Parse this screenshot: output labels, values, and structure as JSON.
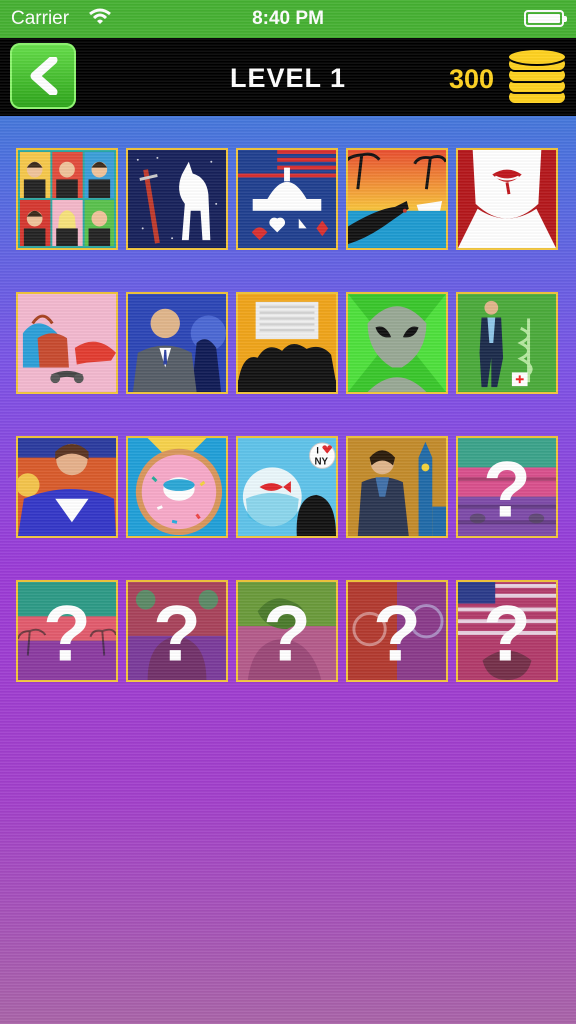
{
  "status_bar": {
    "carrier": "Carrier",
    "time": "8:40 PM"
  },
  "header": {
    "title": "LEVEL 1",
    "coins": "300"
  },
  "colors": {
    "accent_green": "#45b131",
    "coin_gold": "#ffd21e",
    "tile_border": "#f2c53a"
  },
  "tiles": [
    {
      "id": 1,
      "state": "solved",
      "icon": "portraits-grid-icon"
    },
    {
      "id": 2,
      "state": "solved",
      "icon": "sword-wolf-icon"
    },
    {
      "id": 3,
      "state": "solved",
      "icon": "capitol-cards-icon"
    },
    {
      "id": 4,
      "state": "solved",
      "icon": "bloody-hand-beach-icon"
    },
    {
      "id": 5,
      "state": "solved",
      "icon": "vampire-lips-icon"
    },
    {
      "id": 6,
      "state": "solved",
      "icon": "bags-shoes-icon"
    },
    {
      "id": 7,
      "state": "solved",
      "icon": "man-in-suit-icon"
    },
    {
      "id": 8,
      "state": "solved",
      "icon": "couch-silhouette-icon"
    },
    {
      "id": 9,
      "state": "solved",
      "icon": "alien-icon"
    },
    {
      "id": 10,
      "state": "solved",
      "icon": "doctor-caduceus-icon"
    },
    {
      "id": 11,
      "state": "solved",
      "icon": "superman-shirt-icon"
    },
    {
      "id": 12,
      "state": "solved",
      "icon": "donut-icon"
    },
    {
      "id": 13,
      "state": "solved",
      "icon": "fishbowl-ny-icon"
    },
    {
      "id": 14,
      "state": "solved",
      "icon": "detective-big-ben-icon"
    },
    {
      "id": 15,
      "state": "locked",
      "icon": "question-mark-icon"
    },
    {
      "id": 16,
      "state": "locked",
      "icon": "question-mark-icon"
    },
    {
      "id": 17,
      "state": "locked",
      "icon": "question-mark-icon"
    },
    {
      "id": 18,
      "state": "locked",
      "icon": "question-mark-icon"
    },
    {
      "id": 19,
      "state": "locked",
      "icon": "question-mark-icon"
    },
    {
      "id": 20,
      "state": "locked",
      "icon": "question-mark-icon"
    }
  ],
  "tile_badges": {
    "ny_badge_heart": "I",
    "ny_badge_ny": "NY"
  },
  "locked_symbol": "?"
}
